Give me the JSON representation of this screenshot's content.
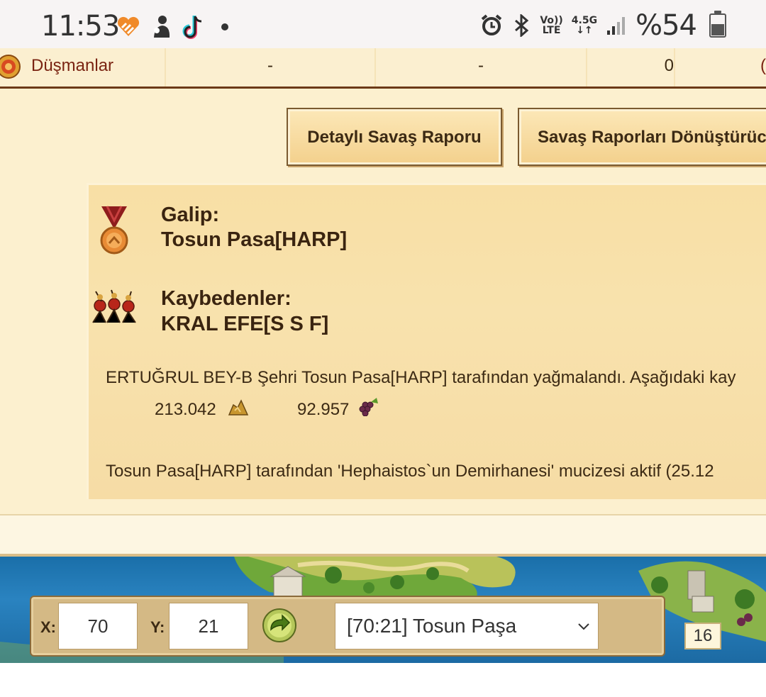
{
  "status_bar": {
    "time": "11:53",
    "battery_text": "%54",
    "network_top": "Vo))",
    "network_bottom": "LTE",
    "data_top": "4.5G",
    "battery_level": 0.54
  },
  "table_row": {
    "label": "Düşmanlar",
    "col1": "-",
    "col2": "-",
    "col3": "0",
    "col4": "("
  },
  "buttons": {
    "detailed_report": "Detaylı Savaş Raporu",
    "converter": "Savaş Raporları Dönüştürücü"
  },
  "report": {
    "winner_heading": "Galip:",
    "winner_name": "Tosun Pasa[HARP]",
    "losers_heading": "Kaybedenler:",
    "loser_name": "KRAL EFE[S S F]",
    "plunder_text": "ERTUĞRUL BEY-B Şehri Tosun Pasa[HARP] tarafından yağmalandı. Aşağıdaki kay",
    "resource1_value": "213.042",
    "resource2_value": "92.957",
    "miracle_text": "Tosun Pasa[HARP] tarafından 'Hephaistos`un Demirhanesi' mucizesi aktif (25.12"
  },
  "coords": {
    "x_label": "X:",
    "x_value": "70",
    "y_label": "Y:",
    "y_value": "21",
    "city_select": "[70:21] Tosun Paşa",
    "badge": "16"
  },
  "colors": {
    "panel_bg": "#fcf0cf",
    "report_bg": "#f8e2ad",
    "enemy_text": "#7a2412",
    "dark_text": "#3c2a14"
  }
}
